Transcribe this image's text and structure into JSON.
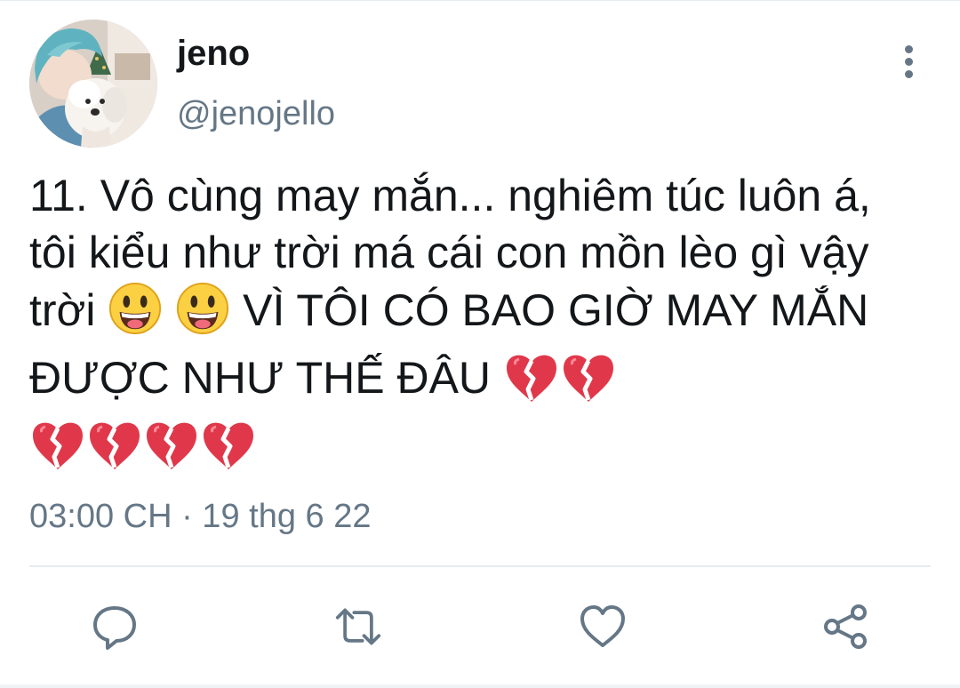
{
  "tweet": {
    "author": {
      "display_name": "jeno",
      "handle": "@jenojello"
    },
    "text_segments": [
      "11. Vô cùng may mắn... nghiêm túc luôn á, tôi kiểu như trời má cái con mồn lèo gì vậy trời ",
      " VÌ TÔI CÓ BAO GIỜ MAY MẮN ĐƯỢC NHƯ THẾ ĐÂU "
    ],
    "emojis_smile": [
      "grinning-face-emoji",
      "grinning-face-emoji"
    ],
    "emojis_broken_heart": [
      "broken-heart-emoji",
      "broken-heart-emoji",
      "broken-heart-emoji",
      "broken-heart-emoji",
      "broken-heart-emoji",
      "broken-heart-emoji"
    ],
    "timestamp": "03:00 CH · 19 thg 6 22"
  },
  "actions": {
    "reply_icon": "reply-icon",
    "retweet_icon": "retweet-icon",
    "like_icon": "heart-icon",
    "share_icon": "share-icon"
  },
  "colors": {
    "text_primary": "#14171a",
    "text_secondary": "#657786",
    "divider": "#e6ecf0",
    "avatar_hair": "#5fb3c0"
  }
}
